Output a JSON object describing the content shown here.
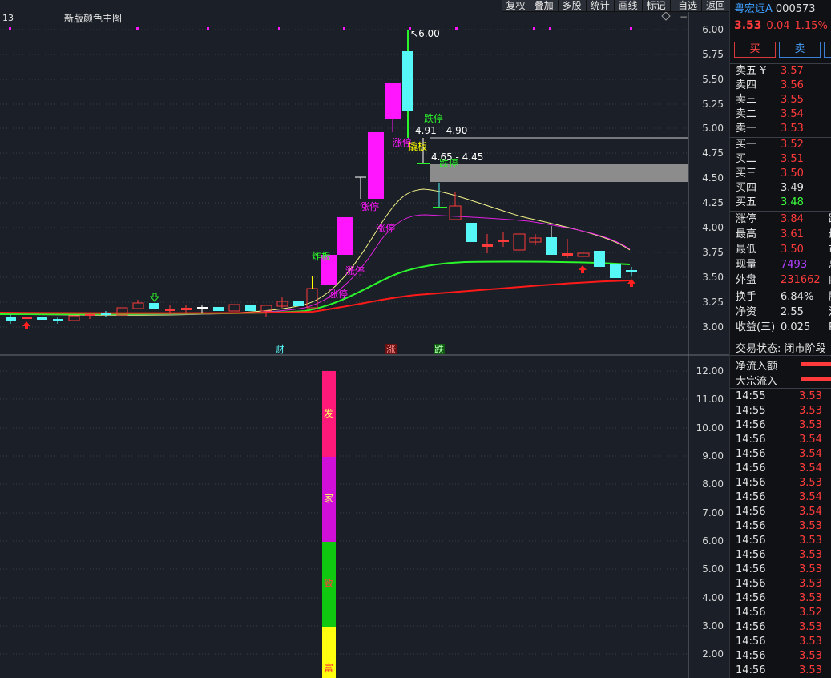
{
  "toolbar": {
    "buttons": [
      "复权",
      "叠加",
      "多股",
      "统计",
      "画线",
      "标记",
      "-自选",
      "返回"
    ]
  },
  "chart": {
    "left_number": "13",
    "indicator_title": "新版颜色主图",
    "top_price_label": "6.00",
    "range1_label": "4.91 - 4.90",
    "range2_label": "4.65 - 4.45",
    "price_ticks": [
      "6.00",
      "5.75",
      "5.50",
      "5.25",
      "5.00",
      "4.75",
      "4.50",
      "4.25",
      "4.00",
      "3.75",
      "3.50",
      "3.25",
      "3.00"
    ],
    "lower_ticks": [
      "12.00",
      "11.00",
      "10.00",
      "9.00",
      "8.00",
      "7.00",
      "6.00",
      "5.00",
      "4.00",
      "3.00",
      "2.00"
    ],
    "date_marks": [
      "财",
      "涨",
      "跌"
    ],
    "annotations": [
      "涨停",
      "涨停",
      "涨停",
      "涨停",
      "涨停",
      "炸板",
      "跌停",
      "撬板",
      "跌停"
    ],
    "bar_texts": [
      "发",
      "家",
      "致",
      "富"
    ],
    "colors": {
      "up": "#ff3b3b",
      "down": "#55f7f7",
      "limit_up": "#ff16ff",
      "ma_white": "#f4f48a",
      "ma_magenta": "#e020e0",
      "ma_green": "#2af52a",
      "ma_red": "#ff1a1a",
      "zone": "#8c8c8c"
    }
  },
  "quote": {
    "name": "粤宏远A",
    "code": "000573",
    "price": "3.53",
    "change": "0.04",
    "change_pct": "1.15%",
    "buy_label": "买",
    "sell_label": "卖",
    "asks": [
      {
        "label": "卖五 ¥",
        "price": "3.57"
      },
      {
        "label": "卖四",
        "price": "3.56"
      },
      {
        "label": "卖三",
        "price": "3.55"
      },
      {
        "label": "卖二",
        "price": "3.54"
      },
      {
        "label": "卖一",
        "price": "3.53"
      }
    ],
    "bids": [
      {
        "label": "买一",
        "price": "3.52"
      },
      {
        "label": "买二",
        "price": "3.51"
      },
      {
        "label": "买三",
        "price": "3.50"
      },
      {
        "label": "买四",
        "price": "3.49"
      },
      {
        "label": "买五",
        "price": "3.48"
      }
    ],
    "stats": [
      {
        "label": "涨停",
        "value": "3.84",
        "extra": "跌"
      },
      {
        "label": "最高",
        "value": "3.61",
        "extra": "最"
      },
      {
        "label": "最低",
        "value": "3.50",
        "extra": "市"
      },
      {
        "label": "现量",
        "value": "7493",
        "extra": "总"
      },
      {
        "label": "外盘",
        "value": "231662",
        "extra": "内"
      }
    ],
    "stats2": [
      {
        "label": "换手",
        "value": "6.84%",
        "extra": "股"
      },
      {
        "label": "净资",
        "value": "2.55",
        "extra": "流"
      },
      {
        "label": "收益(三)",
        "value": "0.025",
        "extra": "PE"
      }
    ],
    "trade_state": "交易状态: 闭市阶段",
    "net_inflow_label": "净流入额",
    "block_inflow_label": "大宗流入",
    "ticks": [
      {
        "time": "14:55",
        "price": "3.53"
      },
      {
        "time": "14:55",
        "price": "3.53"
      },
      {
        "time": "14:56",
        "price": "3.53"
      },
      {
        "time": "14:56",
        "price": "3.54"
      },
      {
        "time": "14:56",
        "price": "3.54"
      },
      {
        "time": "14:56",
        "price": "3.54"
      },
      {
        "time": "14:56",
        "price": "3.53"
      },
      {
        "time": "14:56",
        "price": "3.54"
      },
      {
        "time": "14:56",
        "price": "3.54"
      },
      {
        "time": "14:56",
        "price": "3.53"
      },
      {
        "time": "14:56",
        "price": "3.53"
      },
      {
        "time": "14:56",
        "price": "3.53"
      },
      {
        "time": "14:56",
        "price": "3.53"
      },
      {
        "time": "14:56",
        "price": "3.53"
      },
      {
        "time": "14:56",
        "price": "3.53"
      },
      {
        "time": "14:56",
        "price": "3.52"
      },
      {
        "time": "14:56",
        "price": "3.53"
      },
      {
        "time": "14:56",
        "price": "3.53"
      },
      {
        "time": "14:56",
        "price": "3.53"
      },
      {
        "time": "14:56",
        "price": "3.53"
      }
    ]
  }
}
